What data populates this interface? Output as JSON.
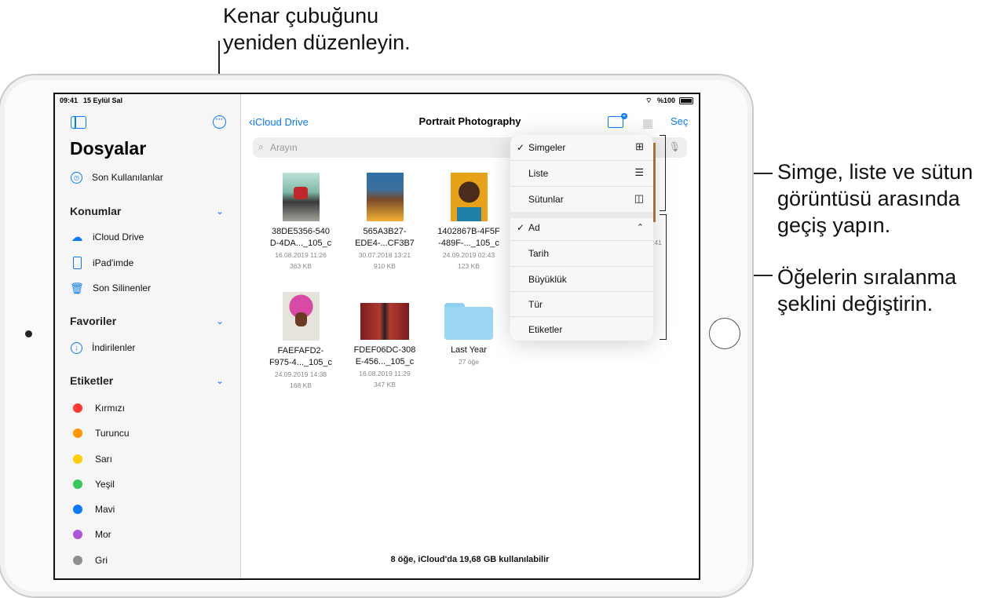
{
  "callouts": {
    "top": [
      "Kenar çubuğunu",
      "yeniden düzenleyin."
    ],
    "view_switch": [
      "Simge, liste ve sütun",
      "görüntüsü arasında",
      "geçiş yapın."
    ],
    "sort_change": [
      "Öğelerin sıralanma",
      "şeklini değiştirin."
    ]
  },
  "status": {
    "time": "09:41",
    "date": "15 Eylül Sal",
    "battery": "%100"
  },
  "sidebar": {
    "title": "Dosyalar",
    "recents": "Son Kullanılanlar",
    "locations_header": "Konumlar",
    "locations": [
      "iCloud Drive",
      "iPad'imde",
      "Son Silinenler"
    ],
    "favorites_header": "Favoriler",
    "favorites": [
      "İndirilenler"
    ],
    "tags_header": "Etiketler",
    "tags": [
      {
        "label": "Kırmızı",
        "color": "#ff3b30"
      },
      {
        "label": "Turuncu",
        "color": "#ff9500"
      },
      {
        "label": "Sarı",
        "color": "#ffcc00"
      },
      {
        "label": "Yeşil",
        "color": "#34c759"
      },
      {
        "label": "Mavi",
        "color": "#0a7aff"
      },
      {
        "label": "Mor",
        "color": "#af52de"
      },
      {
        "label": "Gri",
        "color": "#8e8e93"
      }
    ]
  },
  "nav": {
    "back": "iCloud Drive",
    "title": "Portrait Photography",
    "select": "Seç"
  },
  "search": {
    "placeholder": "Arayın"
  },
  "files": [
    {
      "name1": "38DE5356-540",
      "name2": "D-4DA..._105_c",
      "date": "16.08.2019 11:26",
      "size": "363 KB"
    },
    {
      "name1": "565A3B27-",
      "name2": "EDE4-...CF3B7",
      "date": "30.07.2018 13:21",
      "size": "910 KB"
    },
    {
      "name1": "1402867B-4F5F",
      "name2": "-489F-..._105_c",
      "date": "24.09.2019 02:43",
      "size": "123 KB"
    },
    {
      "name1": "FAEFAFD2-",
      "name2": "F975-4..._105_c",
      "date": "24.09.2019 14:38",
      "size": "168 KB"
    },
    {
      "name1": "FDEF06DC-308",
      "name2": "E-456..._105_c",
      "date": "16.08.2019 11:29",
      "size": "347 KB"
    },
    {
      "name1": "Last Year",
      "name2": "",
      "date": "27 öğe",
      "size": ""
    }
  ],
  "partial_meta": ":41",
  "footer": "8 öğe, iCloud'da 19,68 GB kullanılabilir",
  "menu": {
    "views": [
      {
        "label": "Simgeler",
        "checked": "✓"
      },
      {
        "label": "Liste",
        "checked": ""
      },
      {
        "label": "Sütunlar",
        "checked": ""
      }
    ],
    "sorts": [
      {
        "label": "Ad",
        "checked": "✓"
      },
      {
        "label": "Tarih",
        "checked": ""
      },
      {
        "label": "Büyüklük",
        "checked": ""
      },
      {
        "label": "Tür",
        "checked": ""
      },
      {
        "label": "Etiketler",
        "checked": ""
      }
    ]
  }
}
